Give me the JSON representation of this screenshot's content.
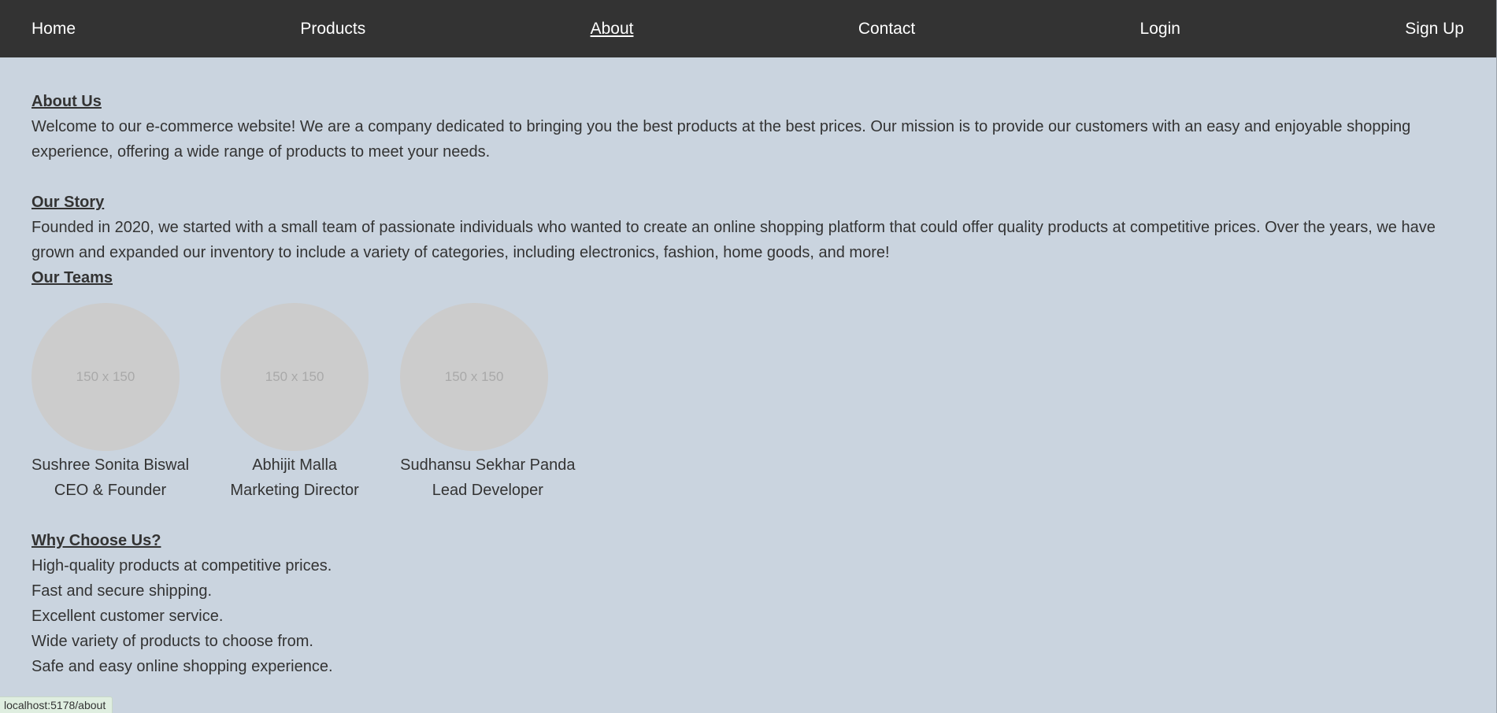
{
  "nav": {
    "items": [
      {
        "label": "Home"
      },
      {
        "label": "Products"
      },
      {
        "label": "About"
      },
      {
        "label": "Contact"
      },
      {
        "label": "Login"
      },
      {
        "label": "Sign Up"
      }
    ],
    "active": "About"
  },
  "about": {
    "title": "About Us",
    "text": "Welcome to our e-commerce website! We are a company dedicated to bringing you the best products at the best prices. Our mission is to provide our customers with an easy and enjoyable shopping experience, offering a wide range of products to meet your needs."
  },
  "story": {
    "title": "Our Story",
    "text": "Founded in 2020, we started with a small team of passionate individuals who wanted to create an online shopping platform that could offer quality products at competitive prices. Over the years, we have grown and expanded our inventory to include a variety of categories, including electronics, fashion, home goods, and more!"
  },
  "teams": {
    "title": "Our Teams",
    "members": [
      {
        "placeholder": "150 x 150",
        "name": "Sushree Sonita Biswal",
        "role": "CEO & Founder"
      },
      {
        "placeholder": "150 x 150",
        "name": "Abhijit Malla",
        "role": "Marketing Director"
      },
      {
        "placeholder": "150 x 150",
        "name": "Sudhansu Sekhar Panda",
        "role": "Lead Developer"
      }
    ]
  },
  "why": {
    "title": "Why Choose Us?",
    "points": [
      "High-quality products at competitive prices.",
      "Fast and secure shipping.",
      "Excellent customer service.",
      "Wide variety of products to choose from.",
      "Safe and easy online shopping experience."
    ]
  },
  "status_bar": {
    "url": "localhost:5178/about"
  },
  "colors": {
    "navbar_bg": "#333333",
    "page_bg": "#cad4df",
    "avatar_bg": "#cccccc",
    "text": "#333333"
  }
}
